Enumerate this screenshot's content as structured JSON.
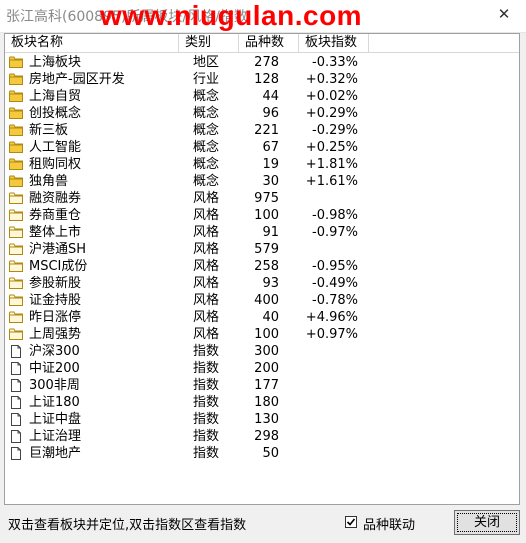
{
  "window": {
    "title": "张江高科(600895)所属板块/风格/指数",
    "watermark": "www.niugulan.com",
    "close_glyph": "✕"
  },
  "table": {
    "columns": [
      "板块名称",
      "类别",
      "品种数",
      "板块指数"
    ],
    "rows": [
      {
        "icon": "folder-filled-icon",
        "name": "上海板块",
        "type": "地区",
        "count": "278",
        "index": "-0.33%"
      },
      {
        "icon": "folder-filled-icon",
        "name": "房地产-园区开发",
        "type": "行业",
        "count": "128",
        "index": "+0.32%"
      },
      {
        "icon": "folder-filled-icon",
        "name": "上海自贸",
        "type": "概念",
        "count": "44",
        "index": "+0.02%"
      },
      {
        "icon": "folder-filled-icon",
        "name": "创投概念",
        "type": "概念",
        "count": "96",
        "index": "+0.29%"
      },
      {
        "icon": "folder-filled-icon",
        "name": "新三板",
        "type": "概念",
        "count": "221",
        "index": "-0.29%"
      },
      {
        "icon": "folder-filled-icon",
        "name": "人工智能",
        "type": "概念",
        "count": "67",
        "index": "+0.25%"
      },
      {
        "icon": "folder-filled-icon",
        "name": "租购同权",
        "type": "概念",
        "count": "19",
        "index": "+1.81%"
      },
      {
        "icon": "folder-filled-icon",
        "name": "独角兽",
        "type": "概念",
        "count": "30",
        "index": "+1.61%"
      },
      {
        "icon": "folder-outline-icon",
        "name": "融资融券",
        "type": "风格",
        "count": "975",
        "index": ""
      },
      {
        "icon": "folder-outline-icon",
        "name": "券商重仓",
        "type": "风格",
        "count": "100",
        "index": "-0.98%"
      },
      {
        "icon": "folder-outline-icon",
        "name": "整体上市",
        "type": "风格",
        "count": "91",
        "index": "-0.97%"
      },
      {
        "icon": "folder-outline-icon",
        "name": "沪港通SH",
        "type": "风格",
        "count": "579",
        "index": ""
      },
      {
        "icon": "folder-outline-icon",
        "name": "MSCI成份",
        "type": "风格",
        "count": "258",
        "index": "-0.95%"
      },
      {
        "icon": "folder-outline-icon",
        "name": "参股新股",
        "type": "风格",
        "count": "93",
        "index": "-0.49%"
      },
      {
        "icon": "folder-outline-icon",
        "name": "证金持股",
        "type": "风格",
        "count": "400",
        "index": "-0.78%"
      },
      {
        "icon": "folder-outline-icon",
        "name": "昨日涨停",
        "type": "风格",
        "count": "40",
        "index": "+4.96%"
      },
      {
        "icon": "folder-outline-icon",
        "name": "上周强势",
        "type": "风格",
        "count": "100",
        "index": "+0.97%"
      },
      {
        "icon": "page-icon",
        "name": "沪深300",
        "type": "指数",
        "count": "300",
        "index": ""
      },
      {
        "icon": "page-icon",
        "name": "中证200",
        "type": "指数",
        "count": "200",
        "index": ""
      },
      {
        "icon": "page-icon",
        "name": "300非周",
        "type": "指数",
        "count": "177",
        "index": ""
      },
      {
        "icon": "page-icon",
        "name": "上证180",
        "type": "指数",
        "count": "180",
        "index": ""
      },
      {
        "icon": "page-icon",
        "name": "上证中盘",
        "type": "指数",
        "count": "130",
        "index": ""
      },
      {
        "icon": "page-icon",
        "name": "上证治理",
        "type": "指数",
        "count": "298",
        "index": ""
      },
      {
        "icon": "page-icon",
        "name": "巨潮地产",
        "type": "指数",
        "count": "50",
        "index": ""
      }
    ]
  },
  "footer": {
    "hint": "双击查看板块并定位,双击指数区查看指数",
    "checkbox_label": "品种联动",
    "checkbox_checked": true,
    "close_label": "关闭"
  },
  "colors": {
    "folder_fill": "#f5c93e",
    "folder_stroke": "#b08a10",
    "watermark": "#ff0000"
  }
}
